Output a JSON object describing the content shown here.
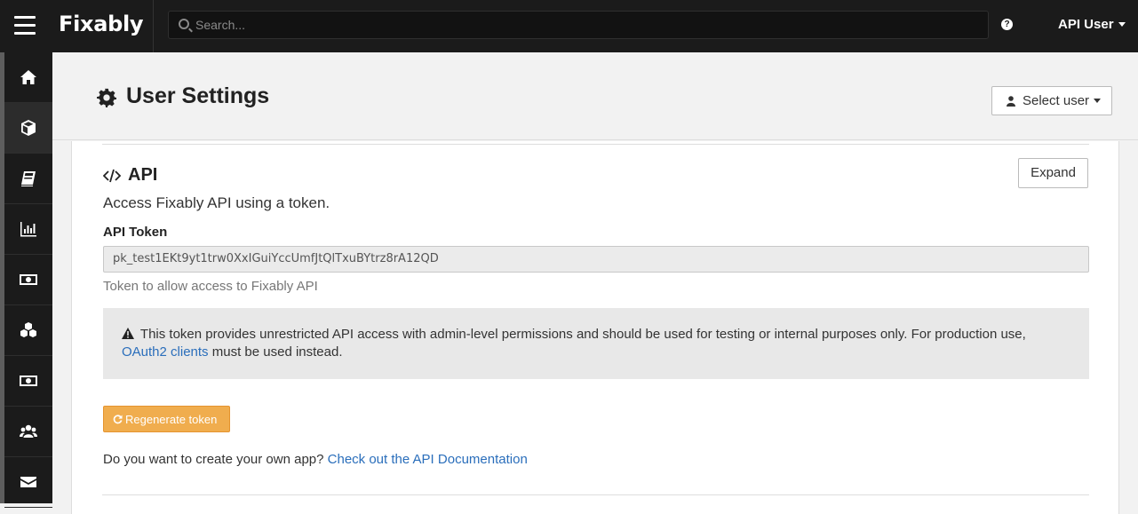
{
  "topbar": {
    "brand": "Fixably",
    "search_placeholder": "Search...",
    "help_icon": "question-circle-icon",
    "user_label": "API User"
  },
  "sidebar": {
    "items": [
      {
        "icon": "home-icon",
        "active": false
      },
      {
        "icon": "cube-icon",
        "active": true
      },
      {
        "icon": "book-icon",
        "active": false
      },
      {
        "icon": "bar-chart-icon",
        "active": false
      },
      {
        "icon": "money-icon",
        "active": false
      },
      {
        "icon": "cubes-icon",
        "active": false
      },
      {
        "icon": "money-icon",
        "active": false
      },
      {
        "icon": "users-icon",
        "active": false
      },
      {
        "icon": "envelope-icon",
        "active": false
      }
    ]
  },
  "header": {
    "title": "User Settings",
    "select_user_label": "Select user"
  },
  "api_section": {
    "title": "API",
    "expand_label": "Expand",
    "description": "Access Fixably API using a token.",
    "token_label": "API Token",
    "token_value": "pk_test1EKt9yt1trw0XxIGuiYccUmfJtQlTxuBYtrz8rA12QD",
    "token_help": "Token to allow access to Fixably API",
    "warning_text_before": "This token provides unrestricted API access with admin-level permissions and should be used for testing or internal purposes only. For production use,",
    "warning_link": "OAuth2 clients",
    "warning_text_after": "must be used instead.",
    "regenerate_label": "Regenerate token",
    "app_question": "Do you want to create your own app?",
    "docs_link": "Check out the API Documentation"
  },
  "colors": {
    "topbar": "#1b1b1b",
    "warning_button": "#f0ad4e",
    "link": "#2a6ebb"
  }
}
